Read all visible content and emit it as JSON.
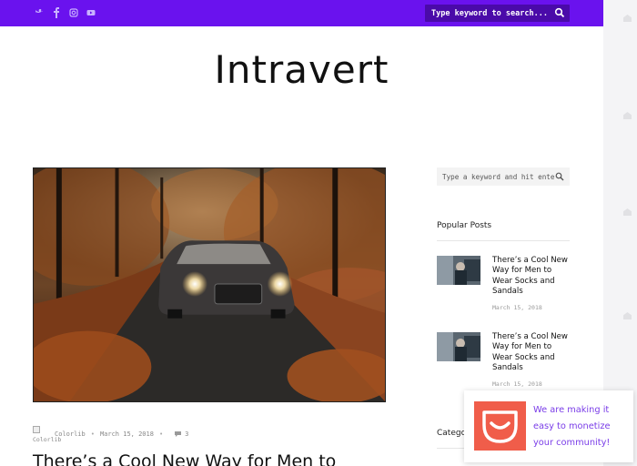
{
  "header": {
    "social_icons": [
      "twitter-icon",
      "facebook-icon",
      "instagram-icon",
      "youtube-icon"
    ],
    "search_placeholder": "Type keyword to search...",
    "accent_color": "#6a12ee"
  },
  "site": {
    "logo": "Intravert"
  },
  "post": {
    "author_alt": "Colorlib",
    "author": "Colorlib",
    "date": "March 15, 2018",
    "separator": "•",
    "comments": "3",
    "title": "There’s a Cool New Way for Men to"
  },
  "sidebar": {
    "search_placeholder": "Type a keyword and hit enter",
    "popular_title": "Popular Posts",
    "popular_posts": [
      {
        "title": "There’s a Cool New Way for Men to Wear Socks and Sandals",
        "date": "March 15, 2018"
      },
      {
        "title": "There’s a Cool New Way for Men to Wear Socks and Sandals",
        "date": "March 15, 2018"
      }
    ],
    "categories_title": "Categories"
  },
  "promo": {
    "text": "We are making it easy to monetize your community!"
  }
}
